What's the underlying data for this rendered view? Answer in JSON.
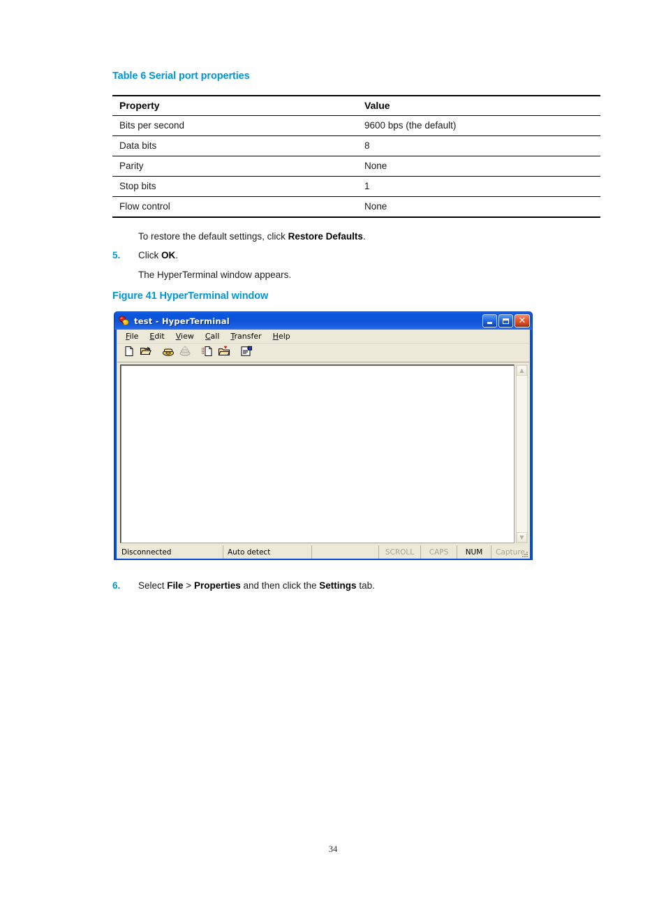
{
  "document": {
    "page_number": "34",
    "table_caption": "Table 6 Serial port properties",
    "figure_caption": "Figure 41 HyperTerminal window",
    "accent_color": "#0096d6"
  },
  "table": {
    "headers": [
      "Property",
      "Value"
    ],
    "rows": [
      [
        "Bits per second",
        "9600 bps (the default)"
      ],
      [
        "Data bits",
        "8"
      ],
      [
        "Parity",
        "None"
      ],
      [
        "Stop bits",
        "1"
      ],
      [
        "Flow control",
        "None"
      ]
    ]
  },
  "steps": {
    "restore_note_prefix": "To restore the default settings, click ",
    "restore_note_bold": "Restore Defaults",
    "restore_note_suffix": ".",
    "step5_num": "5.",
    "step5_prefix": "Click ",
    "step5_bold": "OK",
    "step5_suffix": ".",
    "step5_followup": "The HyperTerminal window appears.",
    "step6_num": "6.",
    "step6_p1": "Select ",
    "step6_b1": "File",
    "step6_p2": " > ",
    "step6_b2": "Properties",
    "step6_p3": " and then click the ",
    "step6_b3": "Settings",
    "step6_p4": " tab."
  },
  "hyperterminal": {
    "title": "test - HyperTerminal",
    "titlebar_color": "#0d54d8",
    "window_buttons": {
      "minimize": "Minimize",
      "maximize": "Maximize",
      "close": "Close"
    },
    "menus": [
      {
        "pre": "",
        "accel": "F",
        "post": "ile"
      },
      {
        "pre": "",
        "accel": "E",
        "post": "dit"
      },
      {
        "pre": "",
        "accel": "V",
        "post": "iew"
      },
      {
        "pre": "",
        "accel": "C",
        "post": "all"
      },
      {
        "pre": "",
        "accel": "T",
        "post": "ransfer"
      },
      {
        "pre": "",
        "accel": "H",
        "post": "elp"
      }
    ],
    "toolbar": [
      {
        "name": "new-connection-icon",
        "label": "New Connection"
      },
      {
        "name": "open-icon",
        "label": "Open"
      },
      {
        "name": "call-icon",
        "label": "Call"
      },
      {
        "name": "disconnect-icon",
        "label": "Disconnect"
      },
      {
        "name": "send-file-icon",
        "label": "Send File"
      },
      {
        "name": "receive-file-icon",
        "label": "Receive File"
      },
      {
        "name": "properties-icon",
        "label": "Properties"
      }
    ],
    "terminal_text": "",
    "scrollbar": {
      "up": "▲",
      "down": "▼"
    },
    "statusbar": [
      {
        "text": "Disconnected",
        "dim": false
      },
      {
        "text": "Auto detect",
        "dim": false
      },
      {
        "text": "",
        "dim": false
      },
      {
        "text": "SCROLL",
        "dim": true
      },
      {
        "text": "CAPS",
        "dim": true
      },
      {
        "text": "NUM",
        "dim": false
      },
      {
        "text": "Capture",
        "dim": true
      }
    ]
  }
}
